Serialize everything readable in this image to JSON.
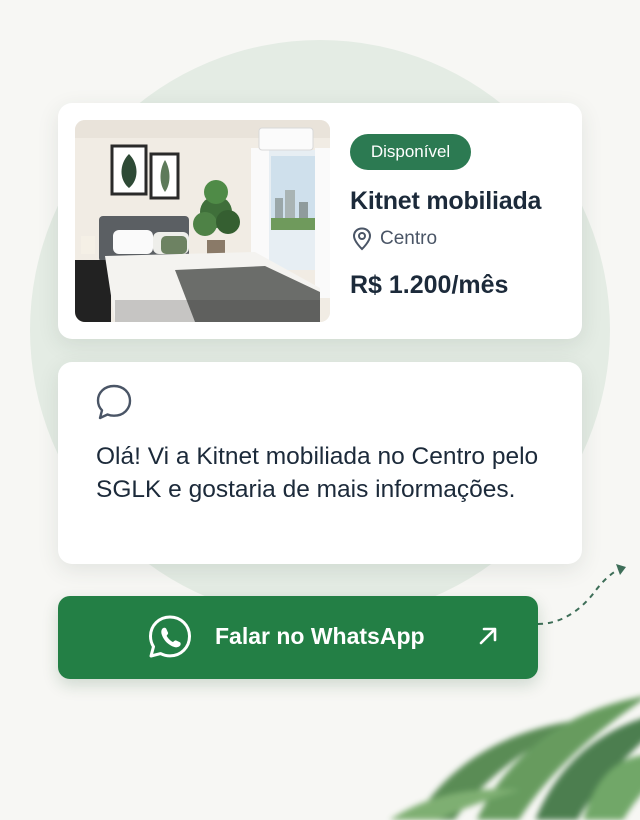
{
  "listing": {
    "badge": "Disponível",
    "title": "Kitnet mobiliada",
    "location": "Centro",
    "price": "R$ 1.200/mês",
    "image": "furnished-bedroom-photo"
  },
  "message": {
    "text": "Olá! Vi a Kitnet mobiliada no Centro pelo SGLK e gostaria de mais informações.",
    "icon": "chat-bubble-icon"
  },
  "cta": {
    "label": "Falar no WhatsApp",
    "icon": "whatsapp-icon",
    "arrow": "arrow-up-right-icon"
  },
  "colors": {
    "primary_green": "#237f45",
    "badge_green": "#2c7a52",
    "background_circle": "#e4ece4",
    "text_dark": "#1c2a3a"
  }
}
